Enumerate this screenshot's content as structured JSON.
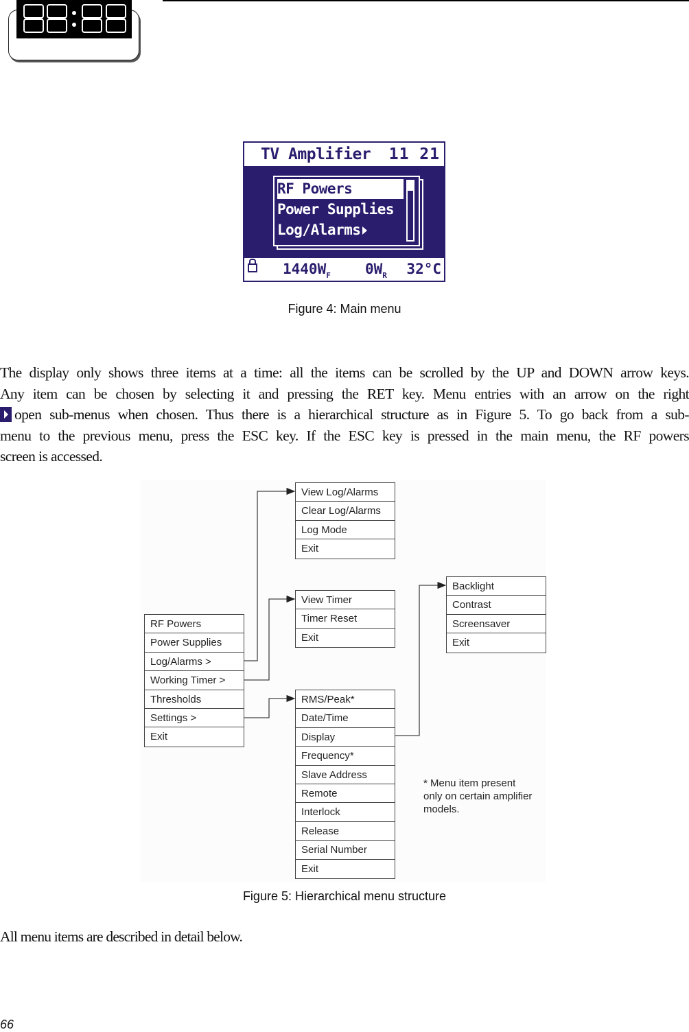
{
  "header": {
    "clock_icon_display": "88:88"
  },
  "figure4": {
    "lcd": {
      "title": "TV Amplifier",
      "time": "11 21",
      "menu_items": [
        {
          "label": "RF Powers",
          "selected": true,
          "has_submenu": false
        },
        {
          "label": "Power Supplies",
          "selected": false,
          "has_submenu": false
        },
        {
          "label": "Log/Alarms",
          "selected": false,
          "has_submenu": true
        }
      ],
      "status": {
        "lock_icon": "lock-icon",
        "forward_power": "1440W",
        "forward_sub": "F",
        "reflected_power": "0W",
        "reflected_sub": "R",
        "temperature": "32°C"
      },
      "colors": {
        "background": "#2b1d6e",
        "foreground": "#ffffff"
      }
    },
    "caption": "Figure 4: Main menu"
  },
  "body": {
    "lines": [
      "The display only shows three items at a time: all the items can be scrolled by the UP and DOWN arrow keys.",
      "Any item can be chosen by selecting it and pressing the RET key. Menu entries with an arrow on the right",
      "open sub-menus when chosen. Thus there is a hierarchical structure as in Figure 5. To go back from a sub-",
      "menu to the previous menu, press the ESC key. If the ESC key is pressed in the main menu, the RF powers",
      "screen is accessed."
    ]
  },
  "figure5": {
    "main_menu": [
      "RF Powers",
      "Power Supplies",
      "Log/Alarms >",
      "Working Timer >",
      "Thresholds",
      "Settings >",
      "Exit"
    ],
    "log_alarms_menu": [
      "View Log/Alarms",
      "Clear Log/Alarms",
      "Log Mode",
      "Exit"
    ],
    "working_timer_menu": [
      "View Timer",
      "Timer Reset",
      "Exit"
    ],
    "settings_menu": [
      "RMS/Peak*",
      "Date/Time",
      "Display",
      "Frequency*",
      "Slave Address",
      "Remote",
      "Interlock",
      "Release",
      "Serial Number",
      "Exit"
    ],
    "display_menu": [
      "Backlight",
      "Contrast",
      "Screensaver",
      "Exit"
    ],
    "note_lines": [
      "* Menu item present",
      "only on certain amplifier",
      "models."
    ],
    "caption": "Figure 5: Hierarchical menu structure"
  },
  "closing": "All menu items are described in detail below.",
  "page_number": "66"
}
